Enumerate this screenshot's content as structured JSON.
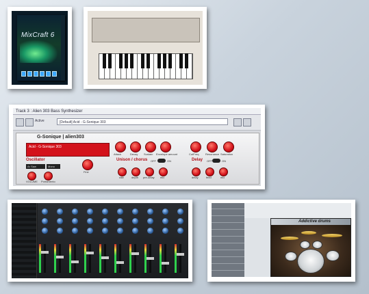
{
  "colors": {
    "accent_red": "#d3121b",
    "mixer_bg": "#1b1d1f"
  },
  "screens": {
    "box": {
      "title": "MixCraft 6"
    },
    "synth": {
      "window_title": "Track 3 : Alien 303 Bass Synthesizer",
      "preset_combo": "[Default] Acid - G-Sonique 303",
      "bypass_label": "Active",
      "brand": "G-Sonique | alien303",
      "preset_name": "Acid - G-Sonique 303",
      "sections": {
        "oscillator": "Oscillator",
        "unison": "Unison / chorus",
        "delay": "Delay"
      },
      "knobs": {
        "attack": "Attack",
        "decay": "Decay",
        "sustain": "Sustain",
        "env_amount": "Envelope amount",
        "cutoff": "CutFreq",
        "resonance": "Resonance",
        "saturation": "Saturation",
        "volume": "VOLUME",
        "portamento": "Portamento",
        "fine": "Fine",
        "rate": "rate",
        "depth": "depth",
        "predelay": "pre-delay",
        "mix": "mix",
        "delay_time": "delay",
        "feedback": "feed",
        "delay_mix": "mix"
      },
      "switches": {
        "off": "OFF",
        "on": "ON"
      },
      "wave_select": "Ar Saw",
      "mono_label": "Mono"
    },
    "drums": {
      "logo": "Addictive drums"
    }
  }
}
